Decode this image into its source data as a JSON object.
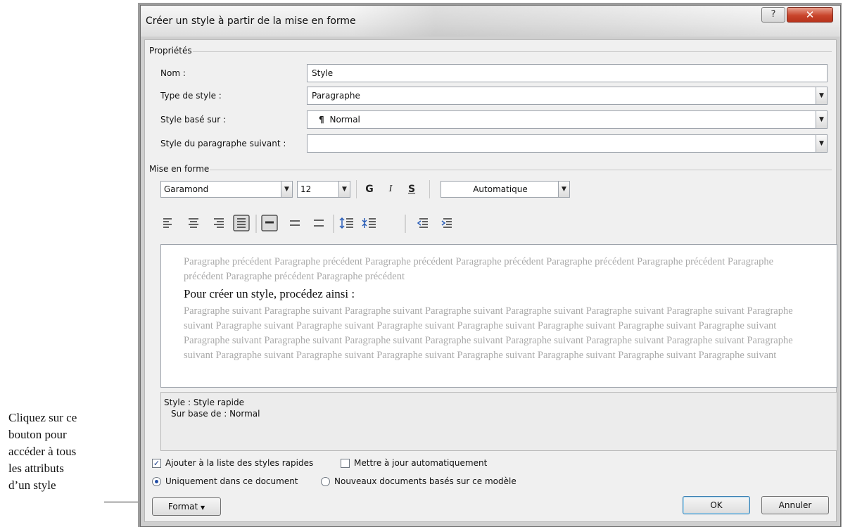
{
  "callout": {
    "lines": [
      "Cliquez sur ce",
      "bouton pour",
      "accéder à tous",
      "les attributs",
      "d’un style"
    ]
  },
  "dialog": {
    "title": "Créer un style à partir de la mise en forme",
    "help_label": "?",
    "close_label": "✕"
  },
  "properties": {
    "section_label": "Propriétés",
    "name_label": "Nom :",
    "name_value": "Style",
    "type_label": "Type de style :",
    "type_value": "Paragraphe",
    "based_on_label": "Style basé sur :",
    "based_on_value": "Normal",
    "next_label": "Style du paragraphe suivant :",
    "next_value": ""
  },
  "formatting": {
    "section_label": "Mise en forme",
    "font_value": "Garamond",
    "size_value": "12",
    "bold_label": "G",
    "italic_label": "I",
    "underline_label": "S",
    "color_value": "Automatique"
  },
  "preview": {
    "prev_para": "Paragraphe précédent Paragraphe précédent Paragraphe précédent Paragraphe précédent Paragraphe précédent Paragraphe précédent Paragraphe précédent Paragraphe précédent Paragraphe précédent",
    "sample": "Pour créer un style, procédez ainsi :",
    "next_para": "Paragraphe suivant Paragraphe suivant Paragraphe suivant Paragraphe suivant Paragraphe suivant Paragraphe suivant Paragraphe suivant Paragraphe suivant Paragraphe suivant Paragraphe suivant Paragraphe suivant Paragraphe suivant Paragraphe suivant Paragraphe suivant Paragraphe suivant Paragraphe suivant Paragraphe suivant Paragraphe suivant Paragraphe suivant Paragraphe suivant Paragraphe suivant Paragraphe suivant Paragraphe suivant Paragraphe suivant Paragraphe suivant Paragraphe suivant Paragraphe suivant Paragraphe suivant Paragraphe suivant Paragraphe suivant"
  },
  "description": {
    "line1": "Style : Style rapide",
    "line2": "Sur base de : Normal"
  },
  "options": {
    "add_quick_styles": "Ajouter à la liste des styles rapides",
    "add_quick_styles_checked": true,
    "auto_update": "Mettre à jour automatiquement",
    "auto_update_checked": false,
    "this_document": "Uniquement dans ce document",
    "new_documents": "Nouveaux documents basés sur ce modèle"
  },
  "buttons": {
    "format": "Format",
    "ok": "OK",
    "cancel": "Annuler"
  }
}
